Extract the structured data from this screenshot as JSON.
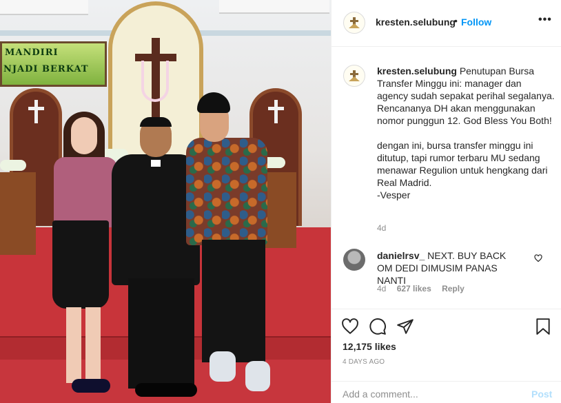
{
  "photo": {
    "banner_line1": "MANDIRI",
    "banner_line2": "NJADI BERKAT"
  },
  "header": {
    "username": "kresten.selubung",
    "separator": "•",
    "follow_label": "Follow",
    "more_icon": "more-options-icon"
  },
  "caption": {
    "username": "kresten.selubung",
    "text": "Penutupan Bursa Transfer Minggu ini: manager dan agency sudah sepakat perihal segalanya. Rencananya DH akan menggunakan nomor punggun 12. God Bless You Both!\n\ndengan ini, bursa transfer minggu ini ditutup, tapi rumor terbaru MU sedang menawar Regulion untuk hengkang dari Real Madrid.\n-Vesper",
    "time": "4d"
  },
  "comments": [
    {
      "username": "danielrsv_",
      "text": "NEXT. BUY BACK OM DEDI DIMUSIM PANAS NANTI",
      "time": "4d",
      "likes": "627 likes",
      "reply_label": "Reply"
    }
  ],
  "actions": {
    "likes_count": "12,175 likes",
    "post_time": "4 DAYS AGO",
    "add_comment_placeholder": "Add a comment...",
    "post_label": "Post"
  },
  "colors": {
    "accent": "#0095f6",
    "post_disabled": "#b2dffc",
    "secondary_text": "#8e8e8e"
  }
}
